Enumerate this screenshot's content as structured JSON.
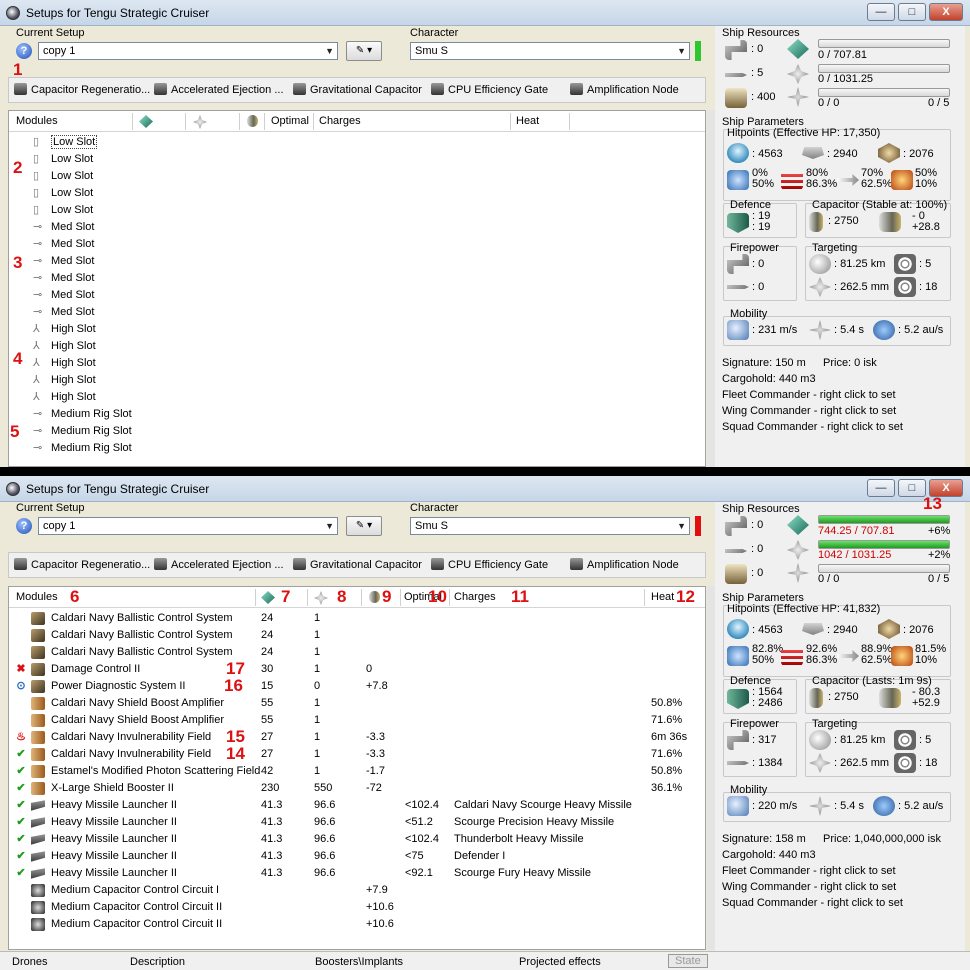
{
  "window": {
    "title": "Setups for Tengu Strategic Cruiser",
    "min": "—",
    "max": "□",
    "close": "X"
  },
  "labels": {
    "current_setup": "Current Setup",
    "character": "Character",
    "ship_resources": "Ship Resources",
    "ship_parameters": "Ship Parameters",
    "defence": "Defence",
    "firepower": "Firepower",
    "targeting": "Targeting",
    "mobility": "Mobility"
  },
  "setup": {
    "name": "copy 1",
    "character": "Smu S"
  },
  "boosters": [
    "Capacitor Regeneratio...",
    "Accelerated Ejection ...",
    "Gravitational Capacitor",
    "CPU Efficiency Gate",
    "Amplification Node"
  ],
  "columns": {
    "modules": "Modules",
    "optimal": "Optimal",
    "charges": "Charges",
    "heat": "Heat"
  },
  "w1": {
    "slots": [
      "Low Slot",
      "Low Slot",
      "Low Slot",
      "Low Slot",
      "Low Slot",
      "Med Slot",
      "Med Slot",
      "Med Slot",
      "Med Slot",
      "Med Slot",
      "Med Slot",
      "High Slot",
      "High Slot",
      "High Slot",
      "High Slot",
      "High Slot",
      "Medium Rig Slot",
      "Medium Rig Slot",
      "Medium Rig Slot"
    ],
    "res": {
      "turrets": ": 0",
      "launchers": ": 5",
      "calib": ": 400",
      "cpu": "0 / 707.81",
      "pg": "0 / 1031.25",
      "drone": "0 / 0",
      "drone_max": "0 / 5"
    },
    "hp_title": "Hitpoints (Effective HP: 17,350)",
    "hp": {
      "shield": ": 4563",
      "armor": ": 2940",
      "hull": ": 2076"
    },
    "res_pct": {
      "em_a": "0%",
      "em_b": "50%",
      "th_a": "80%",
      "th_b": "86.3%",
      "kin_a": "70%",
      "kin_b": "62.5%",
      "exp_a": "50%",
      "exp_b": "10%"
    },
    "defence": {
      "a": ": 19",
      "b": ": 19"
    },
    "cap_title": "Capacitor (Stable at: 100%)",
    "cap": {
      "amount": ": 2750",
      "a": "- 0",
      "b": "+28.8"
    },
    "fire": {
      "a": ": 0",
      "b": ": 0"
    },
    "target": {
      "range": ": 81.25 km",
      "targets": ": 5",
      "scan": ": 262.5 mm",
      "sensor": ": 18"
    },
    "mob": {
      "speed": ": 231 m/s",
      "align": ": 5.4 s",
      "warp": ": 5.2 au/s"
    },
    "info": {
      "signature": "Signature: 150 m",
      "price": "Price: 0 isk",
      "cargo": "Cargohold: 440 m3",
      "fleet": "Fleet Commander - right click to set",
      "wing": "Wing Commander - right click to set",
      "squad": "Squad Commander - right click to set"
    }
  },
  "w2": {
    "modules": [
      {
        "mark": "",
        "name": "Caldari Navy Ballistic Control System",
        "cpu": "24",
        "pg": "1",
        "cal": "",
        "opt": "",
        "chg": "",
        "heat": ""
      },
      {
        "mark": "",
        "name": "Caldari Navy Ballistic Control System",
        "cpu": "24",
        "pg": "1",
        "cal": "",
        "opt": "",
        "chg": "",
        "heat": ""
      },
      {
        "mark": "",
        "name": "Caldari Navy Ballistic Control System",
        "cpu": "24",
        "pg": "1",
        "cal": "",
        "opt": "",
        "chg": "",
        "heat": ""
      },
      {
        "mark": "✖",
        "name": "Damage Control II",
        "cpu": "30",
        "pg": "1",
        "cal": "0",
        "opt": "",
        "chg": "",
        "heat": ""
      },
      {
        "mark": "⊙",
        "name": "Power Diagnostic System II",
        "cpu": "15",
        "pg": "0",
        "cal": "+7.8",
        "opt": "",
        "chg": "",
        "heat": ""
      },
      {
        "mark": "",
        "name": "Caldari Navy Shield Boost Amplifier",
        "cpu": "55",
        "pg": "1",
        "cal": "",
        "opt": "",
        "chg": "",
        "heat": "50.8%"
      },
      {
        "mark": "",
        "name": "Caldari Navy Shield Boost Amplifier",
        "cpu": "55",
        "pg": "1",
        "cal": "",
        "opt": "",
        "chg": "",
        "heat": "71.6%"
      },
      {
        "mark": "♨",
        "name": "Caldari Navy Invulnerability Field",
        "cpu": "27",
        "pg": "1",
        "cal": "-3.3",
        "opt": "",
        "chg": "",
        "heat": "6m 36s"
      },
      {
        "mark": "✔",
        "name": "Caldari Navy Invulnerability Field",
        "cpu": "27",
        "pg": "1",
        "cal": "-3.3",
        "opt": "",
        "chg": "",
        "heat": "71.6%"
      },
      {
        "mark": "✔",
        "name": "Estamel's Modified Photon Scattering Field",
        "cpu": "42",
        "pg": "1",
        "cal": "-1.7",
        "opt": "",
        "chg": "",
        "heat": "50.8%"
      },
      {
        "mark": "✔",
        "name": "X-Large Shield Booster II",
        "cpu": "230",
        "pg": "550",
        "cal": "-72",
        "opt": "",
        "chg": "",
        "heat": "36.1%"
      },
      {
        "mark": "✔",
        "name": "Heavy Missile Launcher II",
        "cpu": "41.3",
        "pg": "96.6",
        "cal": "",
        "opt": "<102.4",
        "chg": "Caldari Navy Scourge Heavy Missile",
        "heat": ""
      },
      {
        "mark": "✔",
        "name": "Heavy Missile Launcher II",
        "cpu": "41.3",
        "pg": "96.6",
        "cal": "",
        "opt": "<51.2",
        "chg": "Scourge Precision Heavy Missile",
        "heat": ""
      },
      {
        "mark": "✔",
        "name": "Heavy Missile Launcher II",
        "cpu": "41.3",
        "pg": "96.6",
        "cal": "",
        "opt": "<102.4",
        "chg": "Thunderbolt Heavy Missile",
        "heat": ""
      },
      {
        "mark": "✔",
        "name": "Heavy Missile Launcher II",
        "cpu": "41.3",
        "pg": "96.6",
        "cal": "",
        "opt": "<75",
        "chg": "Defender I",
        "heat": ""
      },
      {
        "mark": "✔",
        "name": "Heavy Missile Launcher II",
        "cpu": "41.3",
        "pg": "96.6",
        "cal": "",
        "opt": "<92.1",
        "chg": "Scourge Fury Heavy Missile",
        "heat": ""
      },
      {
        "mark": "",
        "name": "Medium Capacitor Control Circuit I",
        "cpu": "",
        "pg": "",
        "cal": "+7.9",
        "opt": "",
        "chg": "",
        "heat": ""
      },
      {
        "mark": "",
        "name": "Medium Capacitor Control Circuit II",
        "cpu": "",
        "pg": "",
        "cal": "+10.6",
        "opt": "",
        "chg": "",
        "heat": ""
      },
      {
        "mark": "",
        "name": "Medium Capacitor Control Circuit II",
        "cpu": "",
        "pg": "",
        "cal": "+10.6",
        "opt": "",
        "chg": "",
        "heat": ""
      }
    ],
    "res": {
      "turrets": ": 0",
      "launchers": ": 0",
      "calib": ": 0",
      "cpu": "744.25 / 707.81",
      "cpu_pct": "+6%",
      "pg": "1042 / 1031.25",
      "pg_pct": "+2%",
      "drone": "0 / 0",
      "drone_max": "0 / 5"
    },
    "hp_title": "Hitpoints (Effective HP: 41,832)",
    "hp": {
      "shield": ": 4563",
      "armor": ": 2940",
      "hull": ": 2076"
    },
    "res_pct": {
      "em_a": "82.8%",
      "em_b": "50%",
      "th_a": "92.6%",
      "th_b": "86.3%",
      "kin_a": "88.9%",
      "kin_b": "62.5%",
      "exp_a": "81.5%",
      "exp_b": "10%"
    },
    "defence": {
      "a": ": 1564",
      "b": ": 2486"
    },
    "cap_title": "Capacitor (Lasts: 1m 9s)",
    "cap": {
      "amount": ": 2750",
      "a": "- 80.3",
      "b": "+52.9"
    },
    "fire": {
      "a": ": 317",
      "b": ": 1384"
    },
    "target": {
      "range": ": 81.25 km",
      "targets": ": 5",
      "scan": ": 262.5 mm",
      "sensor": ": 18"
    },
    "mob": {
      "speed": ": 220 m/s",
      "align": ": 5.4 s",
      "warp": ": 5.2 au/s"
    },
    "info": {
      "signature": "Signature: 158 m",
      "price": "Price: 1,040,000,000 isk",
      "cargo": "Cargohold: 440 m3",
      "fleet": "Fleet Commander - right click to set",
      "wing": "Wing Commander - right click to set",
      "squad": "Squad Commander - right click to set"
    },
    "footer": {
      "drones": "Drones",
      "desc": "Description",
      "boost": "Boosters\\Implants",
      "proj": "Projected effects",
      "state": "State"
    }
  },
  "annotations": {
    "a1": "1",
    "a2": "2",
    "a3": "3",
    "a4": "4",
    "a5": "5",
    "a6": "6",
    "a7": "7",
    "a8": "8",
    "a9": "9",
    "a10": "10",
    "a11": "11",
    "a12": "12",
    "a13": "13",
    "a14": "14",
    "a15": "15",
    "a16": "16",
    "a17": "17"
  },
  "colors": {
    "accent_green": "#2ec82e",
    "accent_red": "#e01010",
    "annotation": "#d11111",
    "over_limit": "#d00000"
  }
}
